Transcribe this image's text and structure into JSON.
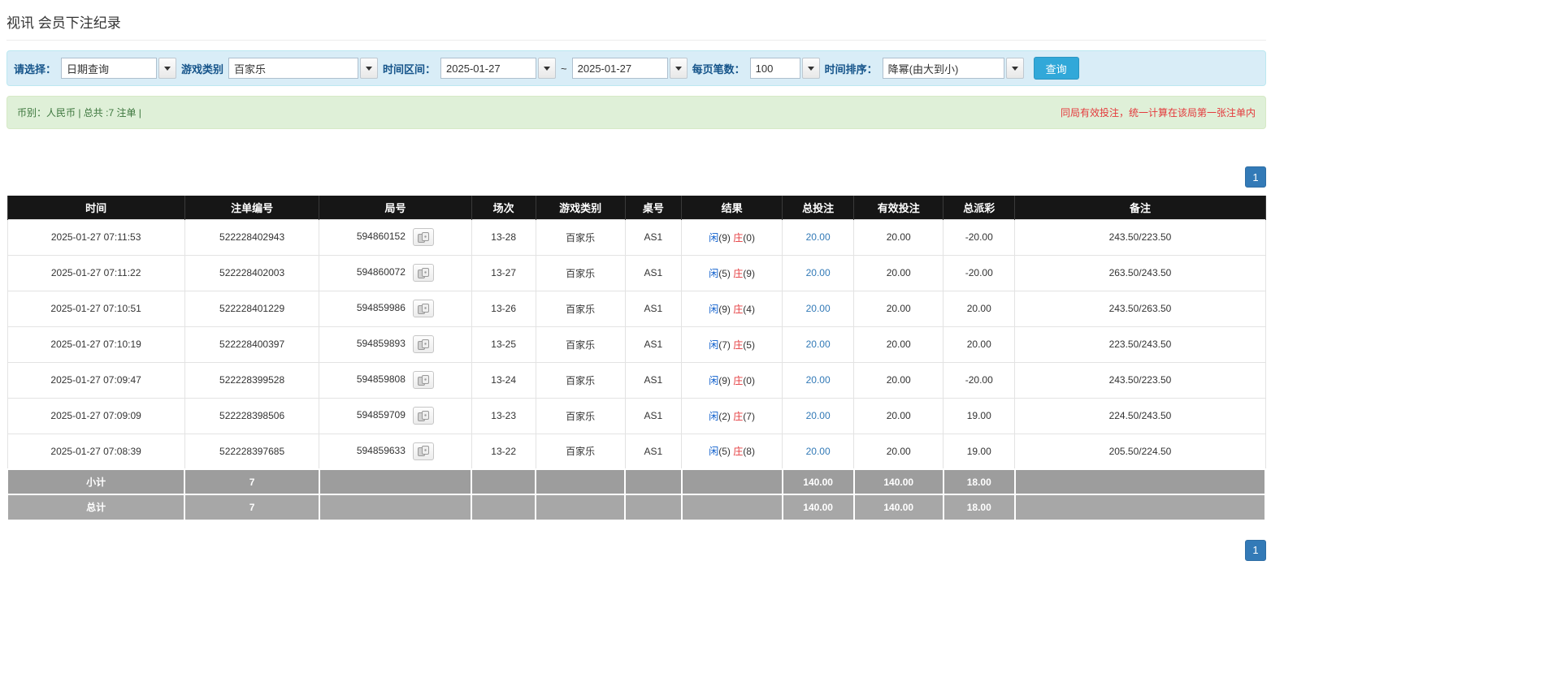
{
  "colors": {
    "label_blue": "#15548a",
    "link_blue": "#337ab7",
    "player_blue": "#0a5ccc",
    "banker_red": "#e4393c",
    "neg_red": "#e4393c",
    "btn_blue": "#31a8d9",
    "pager_blue": "#337ab7",
    "header_bg": "#161616",
    "footer_gray": "#9d9d9d",
    "footer_gray2": "#a7a7a7",
    "filter_bg": "#d9edf7",
    "filter_border": "#bce8f1",
    "info_bg": "#dff0d8",
    "info_border": "#d6e9c6",
    "info_text": "#3c763d"
  },
  "page": {
    "title": "视讯 会员下注纪录"
  },
  "filters": {
    "select_label": "请选择：",
    "select_value": "日期查询",
    "game_label": "游戏类别",
    "game_value": "百家乐",
    "range_label": "时间区间：",
    "date_from": "2025-01-27",
    "range_separator": "~",
    "date_to": "2025-01-27",
    "page_size_label": "每页笔数：",
    "page_size_value": "100",
    "sort_label": "时间排序：",
    "sort_value": "降幂(由大到小)",
    "search_button": "查询"
  },
  "summary": {
    "left": "币别：人民币 | 总共 :7 注单 |",
    "right": "同局有效投注，统一计算在该局第一张注单内"
  },
  "pagination": {
    "page": "1"
  },
  "table": {
    "headers": [
      "时间",
      "注单编号",
      "局号",
      "场次",
      "游戏类别",
      "桌号",
      "结果",
      "总投注",
      "有效投注",
      "总派彩",
      "备注"
    ],
    "rows": [
      {
        "time": "2025-01-27 07:11:53",
        "bet_id": "522228402943",
        "round_id": "594860152",
        "session": "13-28",
        "game": "百家乐",
        "table_no": "AS1",
        "result": {
          "player_label": "闲",
          "player_score": "(9)",
          "banker_label": "庄",
          "banker_score": "(0)"
        },
        "total_bet": "20.00",
        "valid_bet": "20.00",
        "payout": "-20.00",
        "remark": "243.50/223.50"
      },
      {
        "time": "2025-01-27 07:11:22",
        "bet_id": "522228402003",
        "round_id": "594860072",
        "session": "13-27",
        "game": "百家乐",
        "table_no": "AS1",
        "result": {
          "player_label": "闲",
          "player_score": "(5)",
          "banker_label": "庄",
          "banker_score": "(9)"
        },
        "total_bet": "20.00",
        "valid_bet": "20.00",
        "payout": "-20.00",
        "remark": "263.50/243.50"
      },
      {
        "time": "2025-01-27 07:10:51",
        "bet_id": "522228401229",
        "round_id": "594859986",
        "session": "13-26",
        "game": "百家乐",
        "table_no": "AS1",
        "result": {
          "player_label": "闲",
          "player_score": "(9)",
          "banker_label": "庄",
          "banker_score": "(4)"
        },
        "total_bet": "20.00",
        "valid_bet": "20.00",
        "payout": "20.00",
        "remark": "243.50/263.50"
      },
      {
        "time": "2025-01-27 07:10:19",
        "bet_id": "522228400397",
        "round_id": "594859893",
        "session": "13-25",
        "game": "百家乐",
        "table_no": "AS1",
        "result": {
          "player_label": "闲",
          "player_score": "(7)",
          "banker_label": "庄",
          "banker_score": "(5)"
        },
        "total_bet": "20.00",
        "valid_bet": "20.00",
        "payout": "20.00",
        "remark": "223.50/243.50"
      },
      {
        "time": "2025-01-27 07:09:47",
        "bet_id": "522228399528",
        "round_id": "594859808",
        "session": "13-24",
        "game": "百家乐",
        "table_no": "AS1",
        "result": {
          "player_label": "闲",
          "player_score": "(9)",
          "banker_label": "庄",
          "banker_score": "(0)"
        },
        "total_bet": "20.00",
        "valid_bet": "20.00",
        "payout": "-20.00",
        "remark": "243.50/223.50"
      },
      {
        "time": "2025-01-27 07:09:09",
        "bet_id": "522228398506",
        "round_id": "594859709",
        "session": "13-23",
        "game": "百家乐",
        "table_no": "AS1",
        "result": {
          "player_label": "闲",
          "player_score": "(2)",
          "banker_label": "庄",
          "banker_score": "(7)"
        },
        "total_bet": "20.00",
        "valid_bet": "20.00",
        "payout": "19.00",
        "remark": "224.50/243.50"
      },
      {
        "time": "2025-01-27 07:08:39",
        "bet_id": "522228397685",
        "round_id": "594859633",
        "session": "13-22",
        "game": "百家乐",
        "table_no": "AS1",
        "result": {
          "player_label": "闲",
          "player_score": "(5)",
          "banker_label": "庄",
          "banker_score": "(8)"
        },
        "total_bet": "20.00",
        "valid_bet": "20.00",
        "payout": "19.00",
        "remark": "205.50/224.50"
      }
    ],
    "subtotal": {
      "label": "小计",
      "count": "7",
      "total_bet": "140.00",
      "valid_bet": "140.00",
      "payout": "18.00"
    },
    "total": {
      "label": "总计",
      "count": "7",
      "total_bet": "140.00",
      "valid_bet": "140.00",
      "payout": "18.00"
    }
  }
}
